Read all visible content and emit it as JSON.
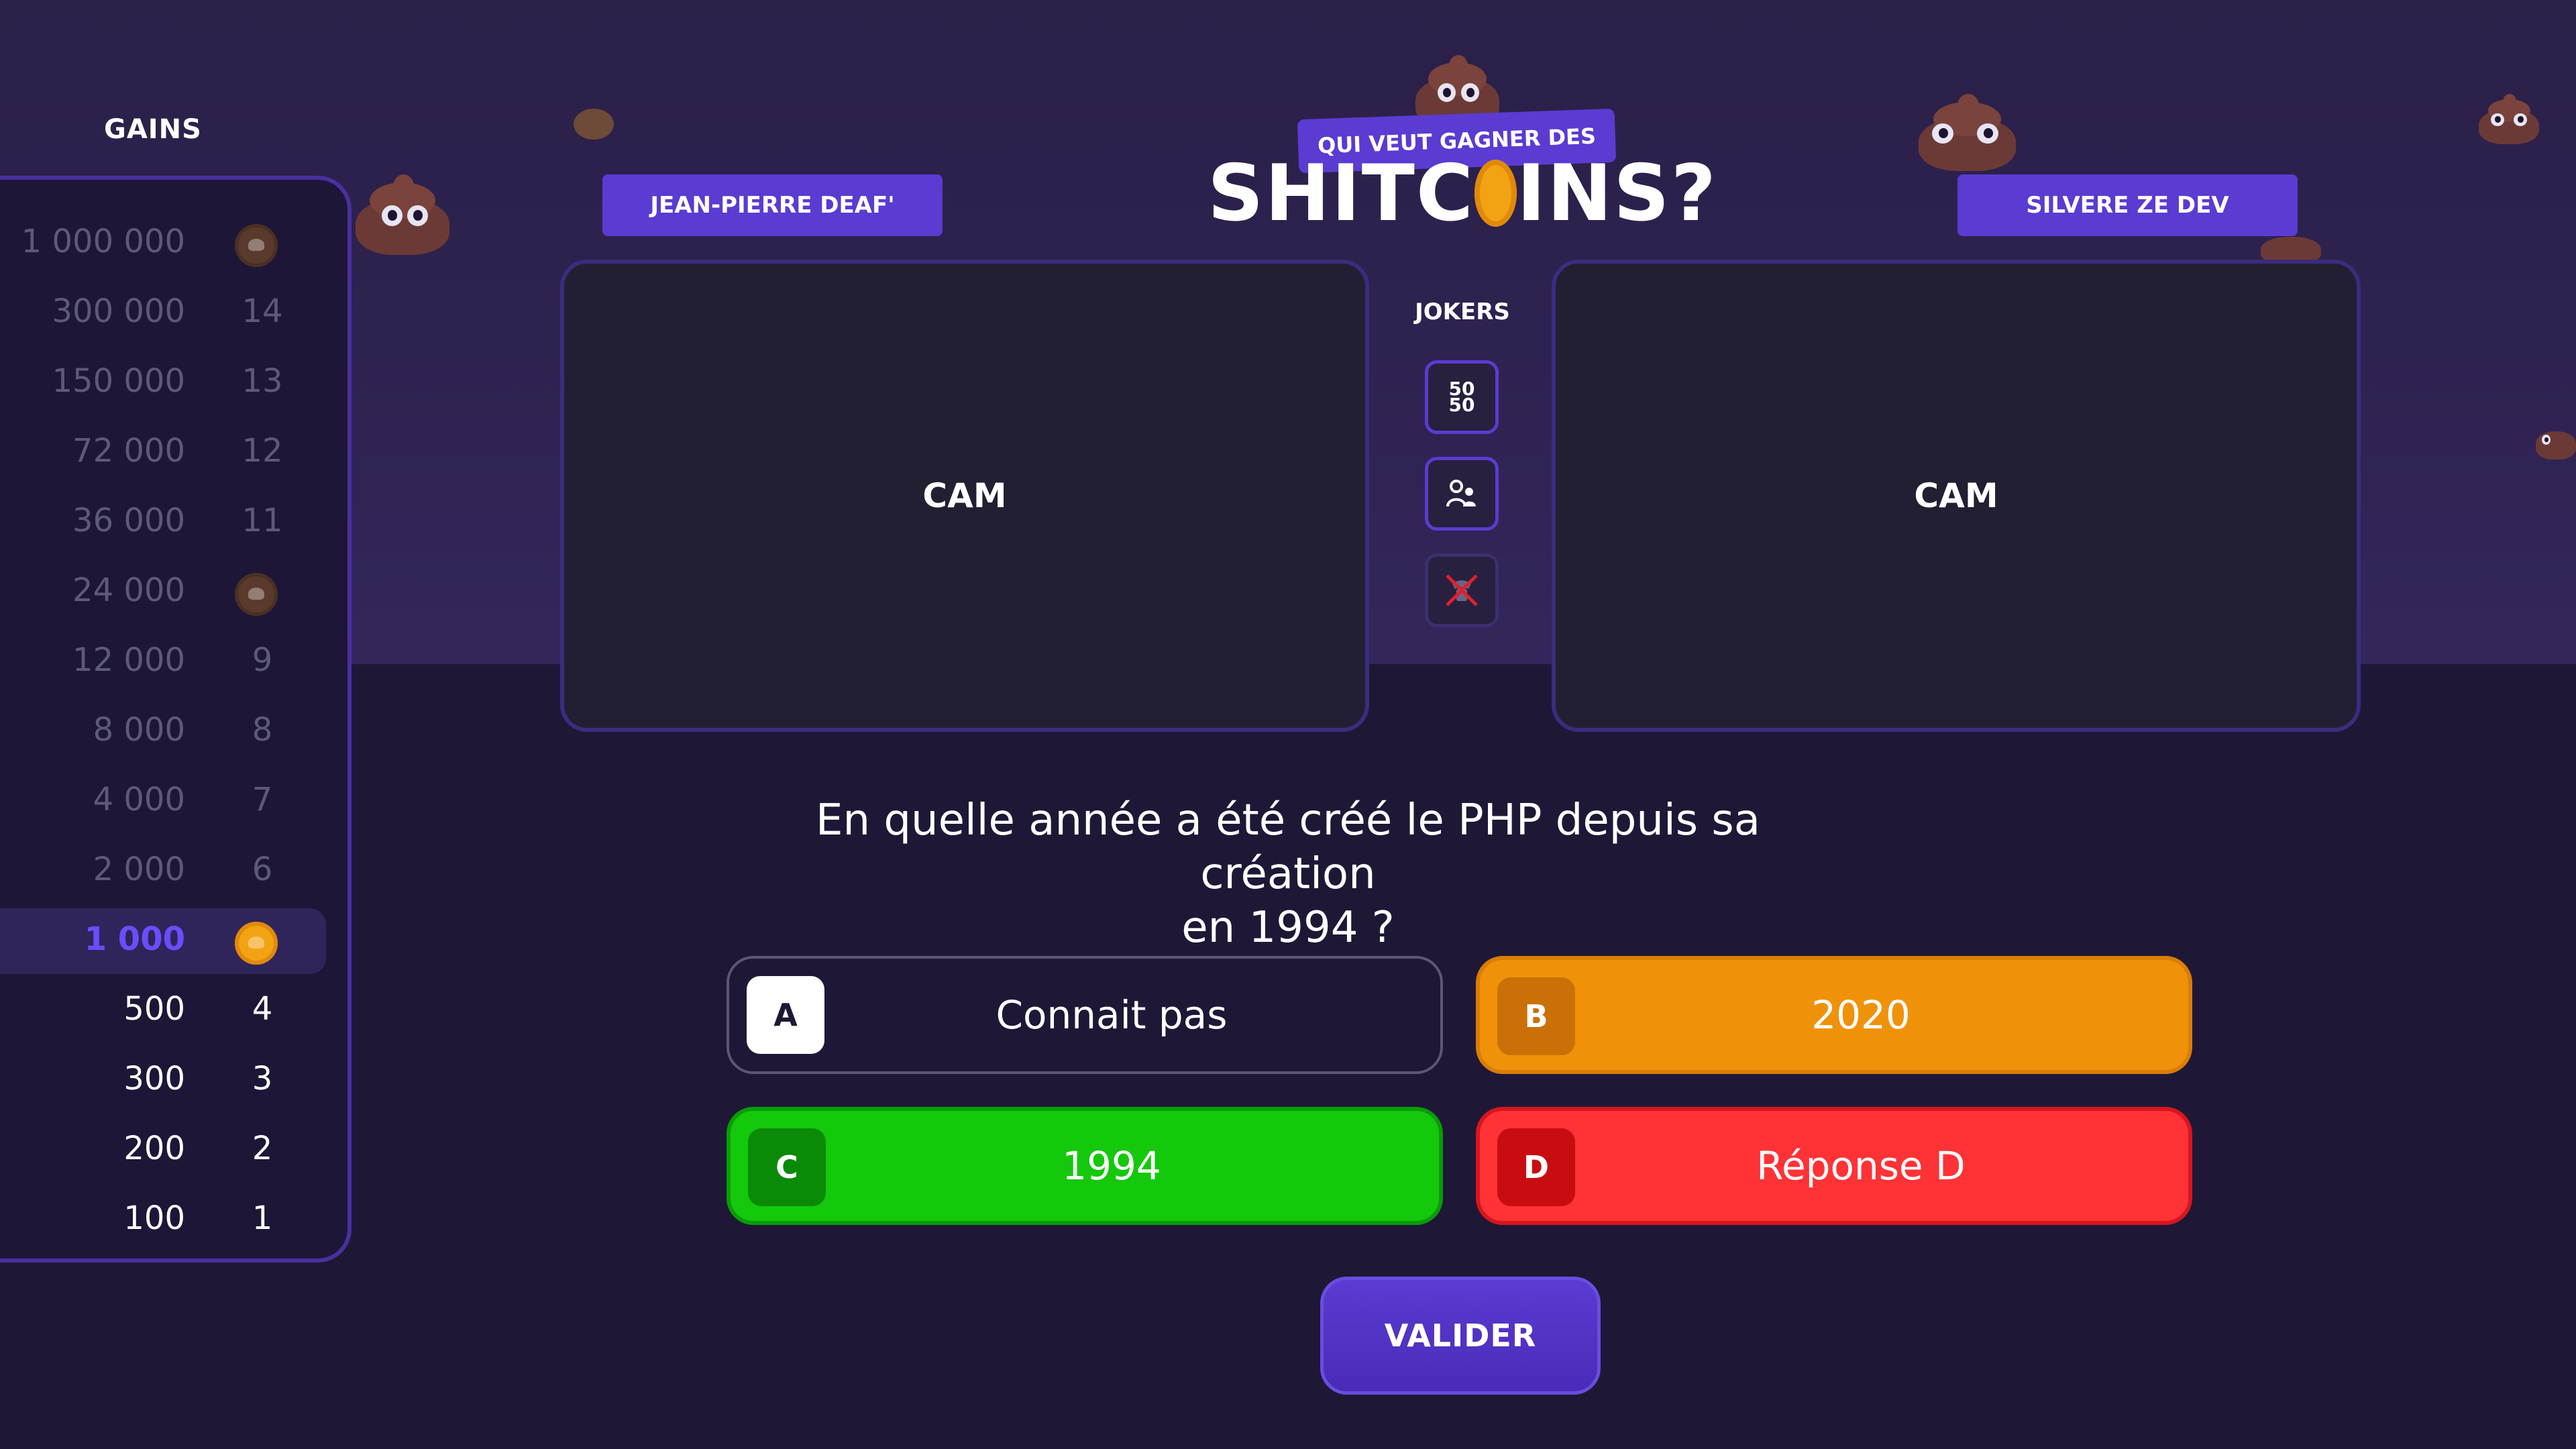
{
  "gains": {
    "title": "GAINS",
    "rows": [
      {
        "amount": "1 000 000",
        "level": "",
        "coin": "dull"
      },
      {
        "amount": "300 000",
        "level": "14"
      },
      {
        "amount": "150 000",
        "level": "13"
      },
      {
        "amount": "72 000",
        "level": "12"
      },
      {
        "amount": "36 000",
        "level": "11"
      },
      {
        "amount": "24 000",
        "level": "",
        "coin": "dull"
      },
      {
        "amount": "12 000",
        "level": "9"
      },
      {
        "amount": "8 000",
        "level": "8"
      },
      {
        "amount": "4 000",
        "level": "7"
      },
      {
        "amount": "2 000",
        "level": "6"
      },
      {
        "amount": "1 000",
        "level": "",
        "coin": "gold",
        "current": true
      },
      {
        "amount": "500",
        "level": "4"
      },
      {
        "amount": "300",
        "level": "3"
      },
      {
        "amount": "200",
        "level": "2"
      },
      {
        "amount": "100",
        "level": "1"
      }
    ]
  },
  "logo": {
    "subtitle": "QUI VEUT GAGNER DES",
    "title_left": "SHITC",
    "title_right": "INS?"
  },
  "players": {
    "left": "JEAN-PIERRE DEAF'",
    "right": "SILVERE ZE DEV"
  },
  "cams": {
    "left_label": "CAM",
    "right_label": "CAM"
  },
  "jokers": {
    "title": "JOKERS",
    "fifty_top": "50",
    "fifty_bottom": "50"
  },
  "question": {
    "line1": "En quelle année a été créé le PHP depuis sa création",
    "line2": "en 1994 ?"
  },
  "answers": [
    {
      "letter": "A",
      "text": "Connait pas"
    },
    {
      "letter": "B",
      "text": "2020"
    },
    {
      "letter": "C",
      "text": "1994"
    },
    {
      "letter": "D",
      "text": "Réponse D"
    }
  ],
  "validate_label": "VALIDER",
  "colors": {
    "accent": "#5b3bd1",
    "answer_b": "#ef920a",
    "answer_c": "#14c80c",
    "answer_d": "#ff3236",
    "coin": "#f2a314"
  }
}
